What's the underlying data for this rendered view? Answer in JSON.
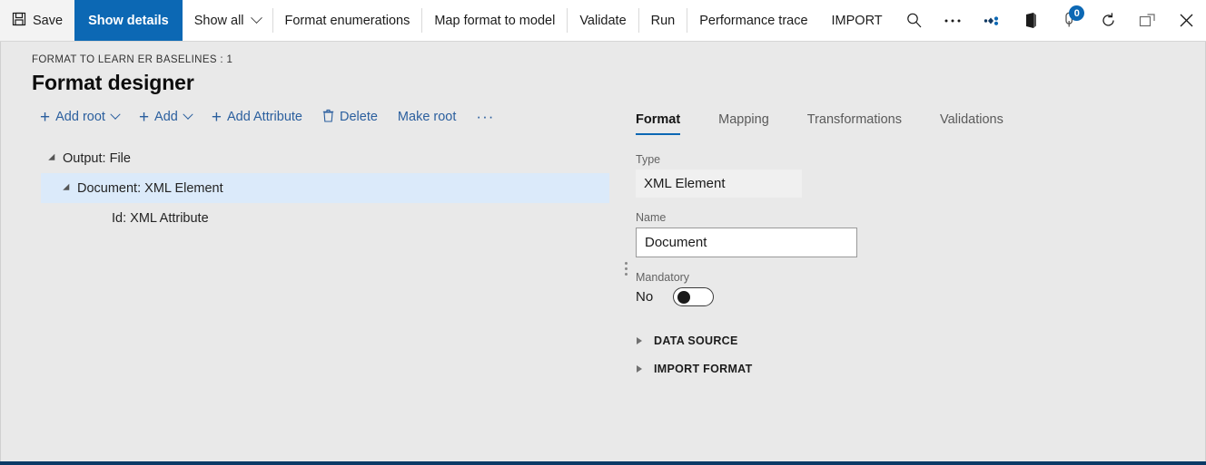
{
  "commandbar": {
    "items": [
      {
        "label": "Save",
        "icon": "save-icon",
        "kind": "icontext"
      },
      {
        "label": "Show details",
        "kind": "primary"
      },
      {
        "label": "Show all",
        "kind": "dropdown"
      },
      {
        "label": "Format enumerations",
        "kind": "text"
      },
      {
        "label": "Map format to model",
        "kind": "text"
      },
      {
        "label": "Validate",
        "kind": "text"
      },
      {
        "label": "Run",
        "kind": "text"
      },
      {
        "label": "Performance trace",
        "kind": "text"
      },
      {
        "label": "IMPORT",
        "kind": "text"
      }
    ],
    "icons": [
      {
        "name": "search-icon",
        "title": "Search"
      },
      {
        "name": "overflow-ellipsis-icon",
        "title": "More"
      },
      {
        "name": "settings-diamond-icon",
        "title": "Settings"
      },
      {
        "name": "office-app-launcher-icon",
        "title": "Office apps"
      },
      {
        "name": "notifications-icon",
        "title": "Notifications",
        "badge": "0"
      },
      {
        "name": "refresh-icon",
        "title": "Refresh"
      },
      {
        "name": "popout-icon",
        "title": "Open in new window"
      },
      {
        "name": "close-icon",
        "title": "Close"
      }
    ]
  },
  "page": {
    "breadcrumb": "FORMAT TO LEARN ER BASELINES : 1",
    "title": "Format designer"
  },
  "actionbar": {
    "add_root": "Add root",
    "add": "Add",
    "add_attribute": "Add Attribute",
    "delete": "Delete",
    "make_root": "Make root",
    "more": "···"
  },
  "tree": {
    "nodes": [
      {
        "label": "Output: File",
        "level": 1,
        "expandable": true,
        "selected": false
      },
      {
        "label": "Document: XML Element",
        "level": 2,
        "expandable": true,
        "selected": true
      },
      {
        "label": "Id: XML Attribute",
        "level": 3,
        "expandable": false,
        "selected": false
      }
    ]
  },
  "details": {
    "tabs": [
      {
        "label": "Format",
        "active": true
      },
      {
        "label": "Mapping",
        "active": false
      },
      {
        "label": "Transformations",
        "active": false
      },
      {
        "label": "Validations",
        "active": false
      }
    ],
    "type_label": "Type",
    "type_value": "XML Element",
    "name_label": "Name",
    "name_value": "Document",
    "mandatory_label": "Mandatory",
    "mandatory_value": "No",
    "sections": [
      {
        "label": "DATA SOURCE",
        "expanded": false
      },
      {
        "label": "IMPORT FORMAT",
        "expanded": false
      }
    ]
  },
  "colors": {
    "accent": "#0c68b4",
    "selection": "#dbeafa",
    "link": "#2b5f9e",
    "page_bg": "#e9e9e9",
    "bottom_bar": "#0b3a66"
  }
}
